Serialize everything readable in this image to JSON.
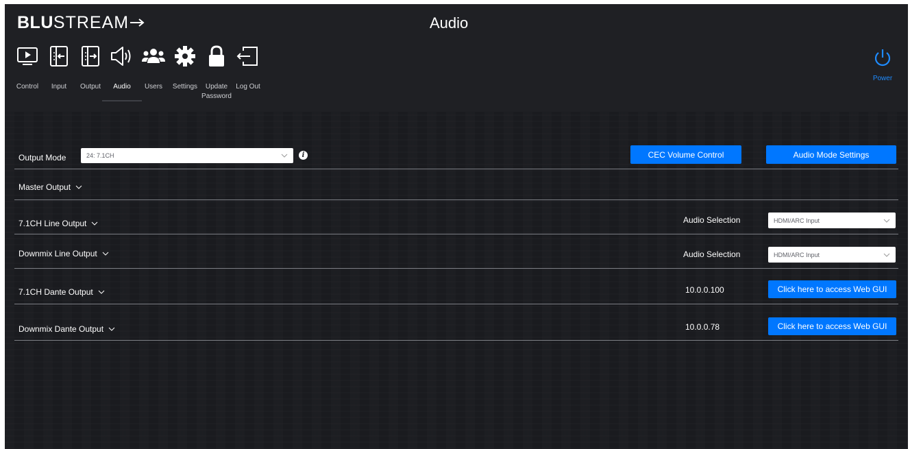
{
  "brand": {
    "bold": "BLU",
    "rest": "STREAM"
  },
  "page_title": "Audio",
  "nav": [
    {
      "label": "Control",
      "icon": "display-icon",
      "active": false
    },
    {
      "label": "Input",
      "icon": "input-icon",
      "active": false
    },
    {
      "label": "Output",
      "icon": "output-icon",
      "active": false
    },
    {
      "label": "Audio",
      "icon": "speaker-icon",
      "active": true
    },
    {
      "label": "Users",
      "icon": "users-icon",
      "active": false
    },
    {
      "label": "Settings",
      "icon": "gear-icon",
      "active": false
    },
    {
      "label": "Update\nPassword",
      "icon": "lock-icon",
      "active": false
    },
    {
      "label": "Log Out",
      "icon": "logout-icon",
      "active": false
    }
  ],
  "power": {
    "label": "Power",
    "icon": "power-icon",
    "color": "#1e8bff"
  },
  "output_mode": {
    "label": "Output Mode",
    "value": "24: 7.1CH",
    "info_icon": "info-icon",
    "cec_button": "CEC Volume Control",
    "audio_mode_button": "Audio Mode Settings"
  },
  "master_output": {
    "label": "Master Output"
  },
  "line_71": {
    "label": "7.1CH Line Output",
    "selection_label": "Audio Selection",
    "selection_value": "HDMI/ARC Input"
  },
  "line_downmix": {
    "label": "Downmix Line Output",
    "selection_label": "Audio Selection",
    "selection_value": "HDMI/ARC Input"
  },
  "dante_71": {
    "label": "7.1CH Dante Output",
    "ip": "10.0.0.100",
    "button": "Click here to access Web GUI"
  },
  "dante_downmix": {
    "label": "Downmix Dante Output",
    "ip": "10.0.0.78",
    "button": "Click here to access Web GUI"
  },
  "colors": {
    "accent": "#0077ff",
    "background": "#1d1e22",
    "divider": "#7d7f85"
  }
}
